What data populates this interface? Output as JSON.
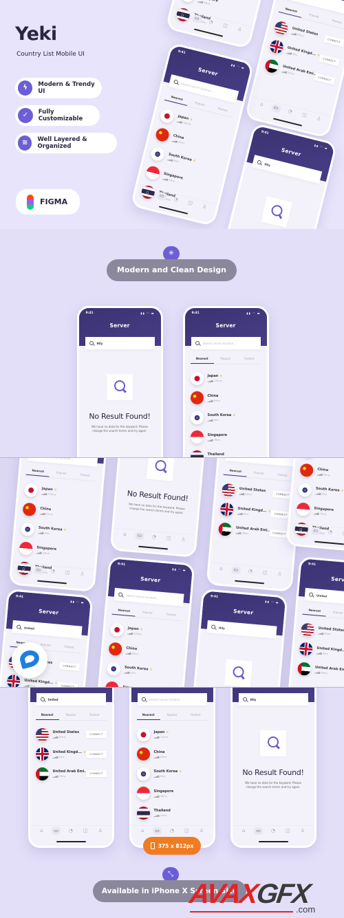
{
  "hero": {
    "title": "Yeki",
    "subtitle": "Country List Mobile UI",
    "features": [
      {
        "label": "Modern & Trendy UI",
        "icon": "lightning-icon"
      },
      {
        "label": "Fully Customizable",
        "icon": "check-circle-icon"
      },
      {
        "label": "Well Layered & Organized",
        "icon": "layers-icon"
      }
    ],
    "figma_label": "FIGMA"
  },
  "section2": {
    "heading": "Modern and Clean Design",
    "icon": "loader-icon"
  },
  "section4": {
    "size_badge": "375 x 812px",
    "heading": "Available in iPhone X Screen Size",
    "icon": "shrink-arrows-icon"
  },
  "watermark": {
    "text": "AVAXGFX",
    "suffix": ".com"
  },
  "colors": {
    "accent": "#6c5ed4",
    "header": "#3b3372",
    "size_badge": "#f07c22",
    "heading_pill": "#8c889c"
  },
  "phone": {
    "time": "9:41",
    "status_icons": "▮▮ ◠ ▬",
    "title": "Server",
    "search_placeholder": "Search server location...",
    "queries": {
      "united": "United",
      "hily": "Hily"
    },
    "tabs": [
      "Nearest",
      "Popular",
      "Fastest"
    ],
    "countries": [
      {
        "name": "Japan",
        "ping": "120ms",
        "premium": true,
        "flag": "jp"
      },
      {
        "name": "China",
        "ping": "63ms",
        "premium": false,
        "flag": "cn"
      },
      {
        "name": "South Korea",
        "ping": "9ms",
        "premium": true,
        "flag": "kr"
      },
      {
        "name": "Singapore",
        "ping": "39ms",
        "premium": false,
        "flag": "sg"
      },
      {
        "name": "Thailand",
        "ping": "10ms",
        "premium": false,
        "flag": "th"
      }
    ],
    "united_results": [
      {
        "name": "United States",
        "ping": "63ms",
        "premium": false,
        "flag": "us"
      },
      {
        "name": "United Kingd...",
        "ping": "9ms",
        "premium": true,
        "flag": "uk"
      },
      {
        "name": "United Arab Emi...",
        "ping": "39ms",
        "premium": false,
        "flag": "ae"
      }
    ],
    "connect_label": "CONNECT",
    "empty_title": "No Result Found!",
    "empty_desc": "We have no data for the keyword. Please change the search terms and try again.",
    "nav_icons": [
      "home-icon",
      "server-icon",
      "speed-icon",
      "chat-icon",
      "user-icon"
    ],
    "active_nav": 1
  }
}
